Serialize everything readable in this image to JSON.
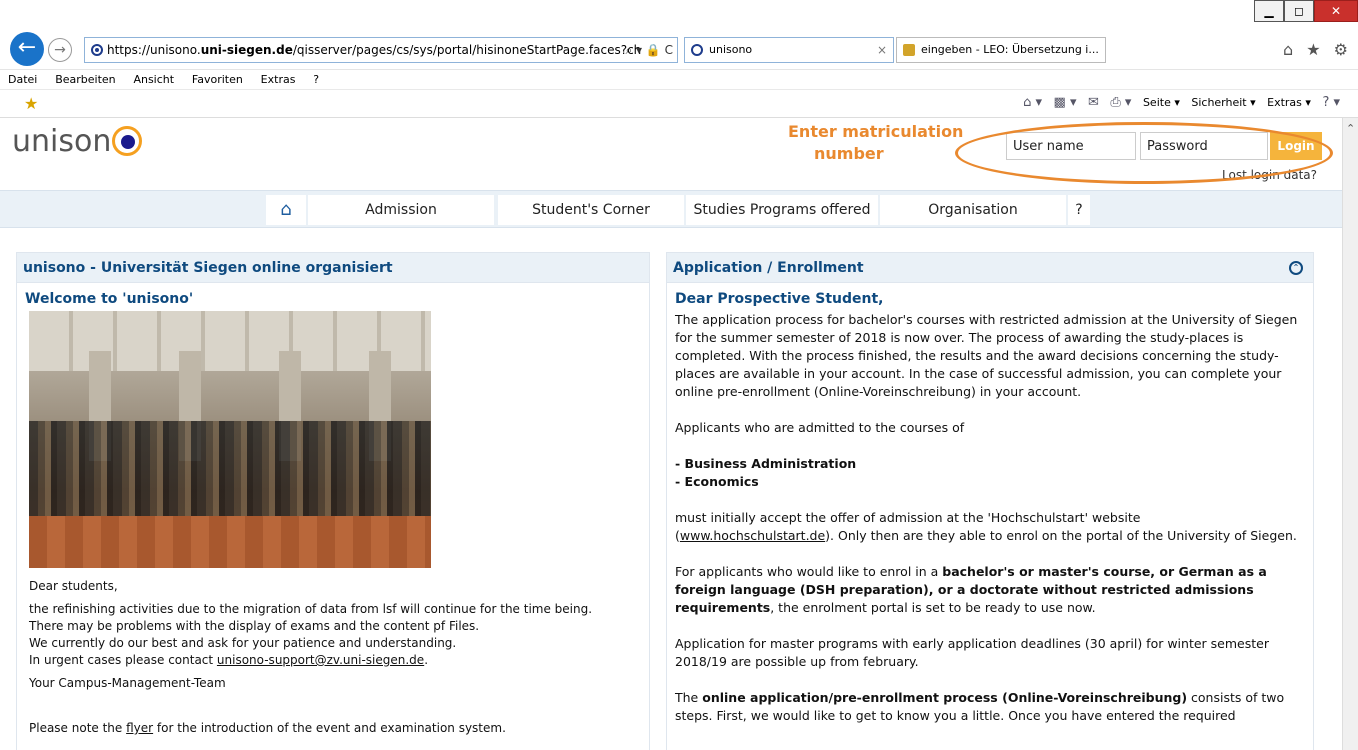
{
  "browser": {
    "url_prefix": "https://unisono.",
    "url_host": "uni-siegen.de",
    "url_rest": "/qisserver/pages/cs/sys/portal/hisinoneStartPage.faces?ch",
    "url_tools": "⌕ ▾ 🔒 C",
    "tabs": [
      {
        "label": "unisono",
        "close": "×"
      },
      {
        "label": "eingeben - LEO: Übersetzung i..."
      }
    ],
    "window_buttons": {
      "minimize": "▁",
      "maximize": "◻",
      "close": "✕"
    },
    "chrome_icons": "⌂ ★ ⚙",
    "menu": [
      "Datei",
      "Bearbeiten",
      "Ansicht",
      "Favoriten",
      "Extras",
      "?"
    ],
    "command_bar": {
      "seite": "Seite ▾",
      "sicherheit": "Sicherheit ▾",
      "extras": "Extras ▾",
      "help": "? ▾"
    }
  },
  "header": {
    "logo_text": "unison",
    "annotation_line1": "Enter matriculation",
    "annotation_line2": "number",
    "username_placeholder": "User name",
    "password_placeholder": "Password",
    "login_label": "Login",
    "lost_login": "Lost login data?"
  },
  "nav": {
    "items": [
      "Admission",
      "Student's Corner",
      "Studies Programs offered",
      "Organisation",
      "?"
    ]
  },
  "left_panel": {
    "title": "unisono - Universität Siegen online organisiert",
    "welcome": "Welcome to 'unisono'",
    "dear_students": "Dear students,",
    "line1": "the refinishing activities due to the migration of data from lsf will continue for the time being.",
    "line2": "There may be problems with the display of exams and the content pf Files.",
    "line3": "We currently do our best and ask for your patience and understanding.",
    "line4_prefix": "In urgent cases please contact ",
    "support_email": "unisono-support@zv.uni-siegen.de",
    "line4_suffix": ".",
    "signature": "Your Campus-Management-Team",
    "note_prefix": "Please note the ",
    "flyer_link": "flyer",
    "note_suffix": " for the introduction of the event and examination system."
  },
  "right_panel": {
    "title": "Application / Enrollment",
    "greeting": "Dear Prospective Student,",
    "p1": "The application process for bachelor's courses with restricted admission at the University of Siegen for the summer semester of 2018 is now over. The process of awarding the study-places is completed. With the process finished, the results and the award decisions concerning the study-places are available in your account. In the case of successful admission, you can complete your online pre-enrollment (Online-Voreinschreibung) in your account.",
    "p2": "Applicants who are admitted to the courses of",
    "course1": "- Business Administration",
    "course2": "- Economics",
    "p3_prefix": "must initially accept the offer of admission at the 'Hochschulstart' website (",
    "p3_link": "www.hochschulstart.de",
    "p3_suffix": "). Only then are they able to enrol on the portal of the University of Siegen.",
    "p4_prefix": "For applicants who would like to enrol in a ",
    "p4_bold": "bachelor's or master's course, or German as a foreign language (DSH preparation), or a doctorate without restricted admissions requirements",
    "p4_suffix": ", the enrolment portal is set to be ready to use now.",
    "p5": "Application for master programs with early application deadlines (30 april) for winter semester 2018/19 are possible up from february.",
    "p6_prefix": "The ",
    "p6_bold": "online application/pre-enrollment process (Online-Voreinschreibung)",
    "p6_suffix": " consists of two steps. First, we would like to get to know you a little. Once you have entered the required"
  },
  "colors": {
    "accent_orange": "#e9892f",
    "login_button": "#f5b43c",
    "heading_blue": "#0f4a7f",
    "nav_background": "#eaf1f7"
  }
}
